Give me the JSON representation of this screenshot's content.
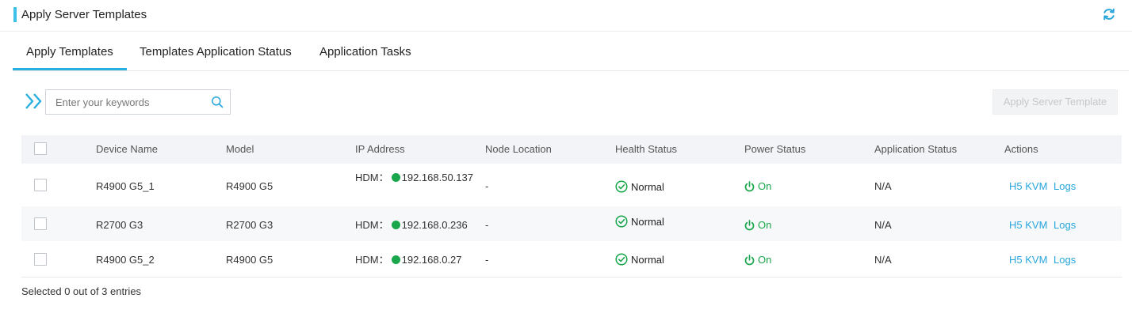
{
  "header": {
    "title": "Apply Server Templates",
    "refresh_icon": "refresh-icon",
    "accent_color": "#3ec1e6"
  },
  "tabs": [
    {
      "label": "Apply Templates",
      "active": true
    },
    {
      "label": "Templates Application Status",
      "active": false
    },
    {
      "label": "Application Tasks",
      "active": false
    }
  ],
  "toolbar": {
    "expand_icon": "double-chevron-right-icon",
    "search": {
      "placeholder": "Enter your keywords",
      "value": "",
      "icon": "search-icon"
    },
    "apply_button_label": "Apply Server Template",
    "apply_button_disabled": true
  },
  "table": {
    "columns": [
      "Device Name",
      "Model",
      "IP Address",
      "Node Location",
      "Health Status",
      "Power Status",
      "Application Status",
      "Actions"
    ],
    "rows": [
      {
        "device_name": "R4900 G5_1",
        "model": "R4900 G5",
        "ip_prefix": "HDM：",
        "ip": "192.168.50.137",
        "node_location": "-",
        "health": "Normal",
        "power": "On",
        "application_status": "N/A",
        "actions": [
          "H5 KVM",
          "Logs"
        ]
      },
      {
        "device_name": "R2700 G3",
        "model": "R2700 G3",
        "ip_prefix": "HDM：",
        "ip": "192.168.0.236",
        "node_location": "-",
        "health": "Normal",
        "power": "On",
        "application_status": "N/A",
        "actions": [
          "H5 KVM",
          "Logs"
        ]
      },
      {
        "device_name": "R4900 G5_2",
        "model": "R4900 G5",
        "ip_prefix": "HDM：",
        "ip": "192.168.0.27",
        "node_location": "-",
        "health": "Normal",
        "power": "On",
        "application_status": "N/A",
        "actions": [
          "H5 KVM",
          "Logs"
        ]
      }
    ]
  },
  "footer": {
    "selection_text": "Selected 0 out of 3 entries"
  },
  "colors": {
    "status_green": "#1aa64b",
    "link_blue": "#27a6dc",
    "tab_underline": "#27b0de"
  }
}
